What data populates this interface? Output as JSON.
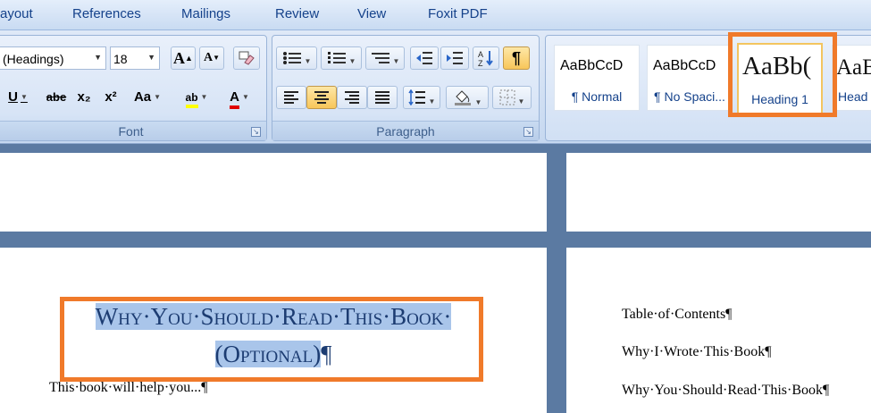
{
  "menu": {
    "tabs": [
      "ayout",
      "References",
      "Mailings",
      "Review",
      "View",
      "Foxit PDF"
    ]
  },
  "font_group": {
    "label": "Font",
    "font_name": "(Headings)",
    "font_size": "18",
    "grow_label": "A",
    "shrink_label": "A",
    "underline_label": "U",
    "strike_label": "abe",
    "subscript_label": "x₂",
    "superscript_label": "x²",
    "case_label": "Aa",
    "highlight_label": "ab",
    "font_color_label": "A"
  },
  "paragraph_group": {
    "label": "Paragraph",
    "show_marks_label": "¶"
  },
  "styles": {
    "tiles": [
      {
        "sample": "AaBbCcD",
        "name": "¶ Normal"
      },
      {
        "sample": "AaBbCcD",
        "name": "¶ No Spaci..."
      },
      {
        "sample": "AaBb(",
        "name": "Heading 1"
      },
      {
        "sample": "AaB",
        "name": "Head"
      }
    ]
  },
  "document": {
    "heading_line1": "Why·You·Should·Read·This·Book·",
    "heading_line2": "(Optional)",
    "heading_pilcrow": "¶",
    "body_line": "This·book·will·help·you...¶",
    "toc_title": "Table·of·Contents¶",
    "toc_item1": "Why·I·Wrote·This·Book¶",
    "toc_item2": "Why·You·Should·Read·This·Book¶"
  },
  "colors": {
    "accent_highlight": "#f07a2a",
    "selection": "#a9c5ea",
    "ribbon_text": "#15428b"
  }
}
